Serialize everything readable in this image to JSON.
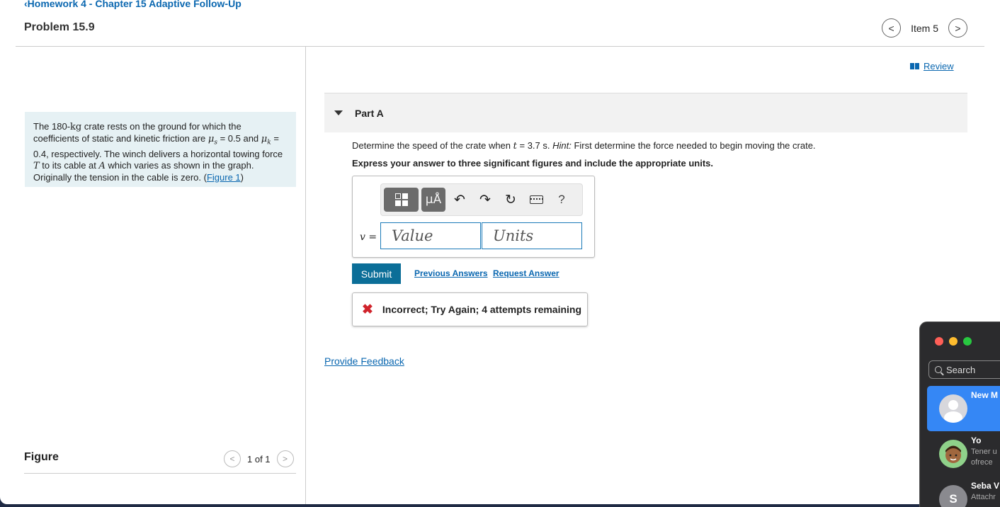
{
  "header": {
    "back_link": "Homework 4 - Chapter 15 Adaptive Follow-Up",
    "problem_title": "Problem 15.9",
    "item_label": "Item 5"
  },
  "problem": {
    "t1": "The 180-",
    "unit_kg": "kg",
    "t2": " crate rests on the ground for which the coefficients of static and kinetic friction are ",
    "mu_s": "μs",
    "t3": " = 0.5 and ",
    "mu_k": "μk",
    "t4": " = 0.4, respectively. The winch delivers a horizontal towing force ",
    "T": "T",
    "t5": " to its cable at ",
    "A": "A",
    "t6": " which varies as shown in the graph. Originally the tension in the cable is zero. (",
    "figure_link": "Figure 1",
    "t7": ")"
  },
  "figure": {
    "title": "Figure",
    "count": "1 of 1"
  },
  "review_link": "Review",
  "part": {
    "label": "Part A",
    "q1": "Determine the speed of the crate when ",
    "q_t": "t",
    "q2": " = 3.7 s. ",
    "hint": "Hint:",
    "q3": " First determine the force needed to begin moving the crate.",
    "instruction": "Express your answer to three significant figures and include the appropriate units."
  },
  "answer": {
    "toolbar_mu": "μÅ",
    "help": "?",
    "var": "v",
    "eq": " =",
    "value_placeholder": "Value",
    "units_placeholder": "Units"
  },
  "actions": {
    "submit": "Submit",
    "previous_answers": "Previous Answers",
    "request_answer": "Request Answer"
  },
  "feedback": {
    "icon": "✖",
    "message": "Incorrect; Try Again; 4 attempts remaining"
  },
  "provide_feedback": "Provide Feedback",
  "overlay": {
    "search": "Search",
    "traffic_colors": [
      "#ff5f57",
      "#febc2e",
      "#28c840"
    ],
    "chats": [
      {
        "name": "New M",
        "preview": "",
        "avatar": "person-icon"
      },
      {
        "name": "Yo",
        "preview": "Tener u\nofrece",
        "avatar": "memoji-icon"
      },
      {
        "name": "Seba V",
        "preview": "Attachr",
        "avatar": "S"
      }
    ]
  }
}
